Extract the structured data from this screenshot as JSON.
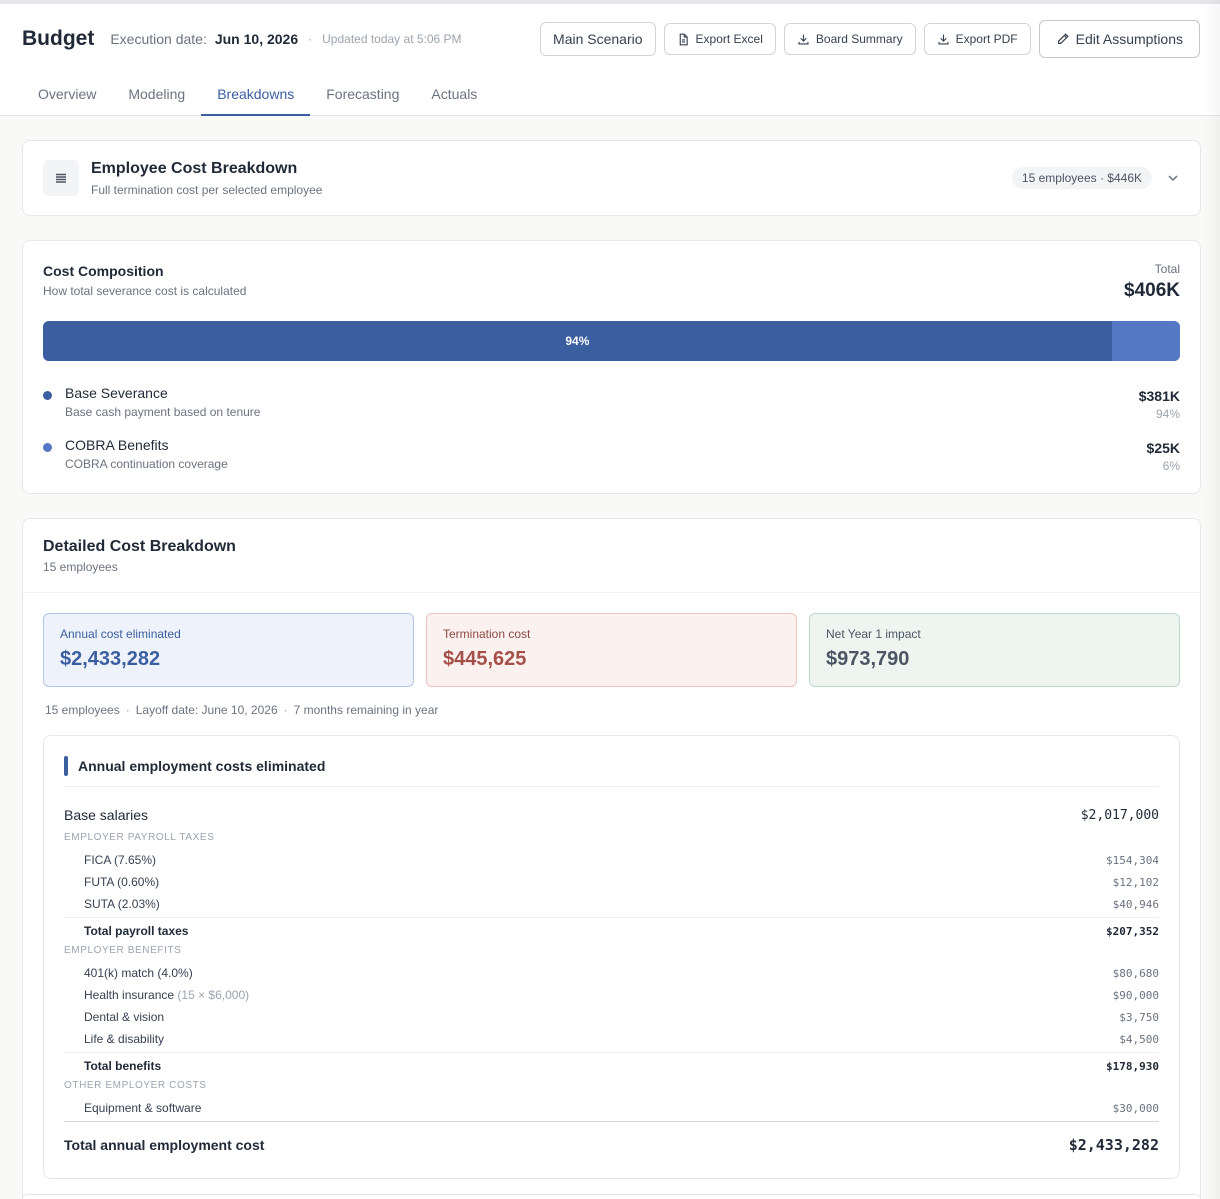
{
  "header": {
    "title": "Budget",
    "execution_label": "Execution date:",
    "execution_date": "Jun 10, 2026",
    "separator": "·",
    "updated": "Updated today at 5:06 PM",
    "buttons": {
      "scenario": "Main Scenario",
      "export_excel": "Export Excel",
      "board_summary": "Board Summary",
      "export_pdf": "Export PDF",
      "edit_assumptions": "Edit Assumptions"
    },
    "tabs": [
      {
        "label": "Overview",
        "active": false
      },
      {
        "label": "Modeling",
        "active": false
      },
      {
        "label": "Breakdowns",
        "active": true
      },
      {
        "label": "Forecasting",
        "active": false
      },
      {
        "label": "Actuals",
        "active": false
      }
    ]
  },
  "employee_card": {
    "title": "Employee Cost Breakdown",
    "subtitle": "Full termination cost per selected employee",
    "badge": "15 employees · $446K",
    "icon": "list-icon"
  },
  "composition": {
    "title": "Cost Composition",
    "subtitle": "How total severance cost is calculated",
    "total_label": "Total",
    "total": "$406K",
    "bar_label": "94%",
    "bar_fraction": 0.94,
    "colors": {
      "base": "#3b5ea0",
      "cobra": "#5478c4"
    },
    "items": [
      {
        "name": "Base Severance",
        "desc": "Base cash payment based on tenure",
        "value": "$381K",
        "pct": "94%"
      },
      {
        "name": "COBRA Benefits",
        "desc": "COBRA continuation coverage",
        "value": "$25K",
        "pct": "6%"
      }
    ]
  },
  "detailed": {
    "title": "Detailed Cost Breakdown",
    "subtitle": "15 employees",
    "stats": {
      "annual": {
        "label": "Annual cost eliminated",
        "value": "$2,433,282"
      },
      "termination": {
        "label": "Termination cost",
        "value": "$445,625"
      },
      "net": {
        "label": "Net Year 1 impact",
        "value": "$973,790"
      }
    },
    "meta": {
      "employees": "15 employees",
      "layoff": "Layoff date: June 10, 2026",
      "remaining": "7 months remaining in year",
      "separator": "·"
    },
    "table": {
      "heading": "Annual employment costs eliminated",
      "base_salaries": {
        "label": "Base salaries",
        "value": "$2,017,000"
      },
      "payroll_section": "Employer payroll taxes",
      "payroll": [
        {
          "label": "FICA (7.65%)",
          "value": "$154,304"
        },
        {
          "label": "FUTA (0.60%)",
          "value": "$12,102"
        },
        {
          "label": "SUTA (2.03%)",
          "value": "$40,946"
        }
      ],
      "payroll_total": {
        "label": "Total payroll taxes",
        "value": "$207,352"
      },
      "benefits_section": "Employer benefits",
      "benefits": [
        {
          "label": "401(k) match (4.0%)",
          "note": "",
          "value": "$80,680"
        },
        {
          "label": "Health insurance",
          "note": "(15 × $6,000)",
          "value": "$90,000"
        },
        {
          "label": "Dental & vision",
          "note": "",
          "value": "$3,750"
        },
        {
          "label": "Life & disability",
          "note": "",
          "value": "$4,500"
        }
      ],
      "benefits_total": {
        "label": "Total benefits",
        "value": "$178,930"
      },
      "other_section": "Other employer costs",
      "other": [
        {
          "label": "Equipment & software",
          "value": "$30,000"
        }
      ],
      "grand_total": {
        "label": "Total annual employment cost",
        "value": "$2,433,282"
      }
    }
  }
}
